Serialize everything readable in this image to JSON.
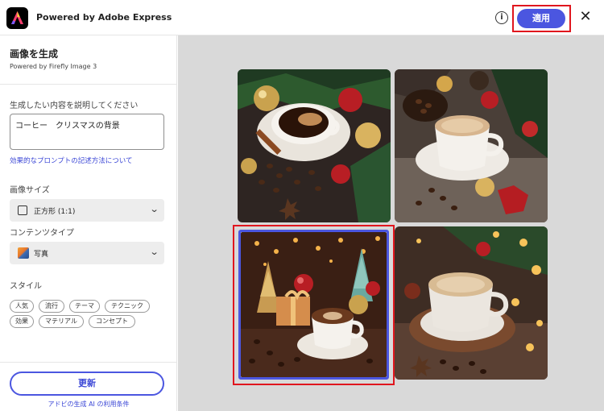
{
  "header": {
    "app_title": "Powered by Adobe Express",
    "info_icon": "info-icon",
    "apply_label": "適用",
    "close_icon": "close-icon",
    "accent_color": "#4b56e0",
    "highlight_color": "#e0161e"
  },
  "sidebar": {
    "title": "画像を生成",
    "subtitle": "Powered by Firefly Image 3",
    "prompt_label": "生成したい内容を説明してください",
    "prompt_value": "コーヒー　クリスマスの背景",
    "prompt_help_link": "効果的なプロンプトの記述方法について",
    "image_size_label": "画像サイズ",
    "image_size_value": "正方形 (1:1)",
    "content_type_label": "コンテンツタイプ",
    "content_type_value": "写真",
    "style_label": "スタイル",
    "style_chips": [
      "人気",
      "流行",
      "テーマ",
      "テクニック",
      "効果",
      "マテリアル",
      "コンセプト"
    ],
    "refresh_label": "更新",
    "terms_link": "アドビの生成 AI の利用条件"
  },
  "results": {
    "images": [
      {
        "subject": "coffee-christmas-1"
      },
      {
        "subject": "coffee-christmas-2"
      },
      {
        "subject": "coffee-christmas-3",
        "selected": true
      },
      {
        "subject": "coffee-christmas-4"
      }
    ]
  }
}
